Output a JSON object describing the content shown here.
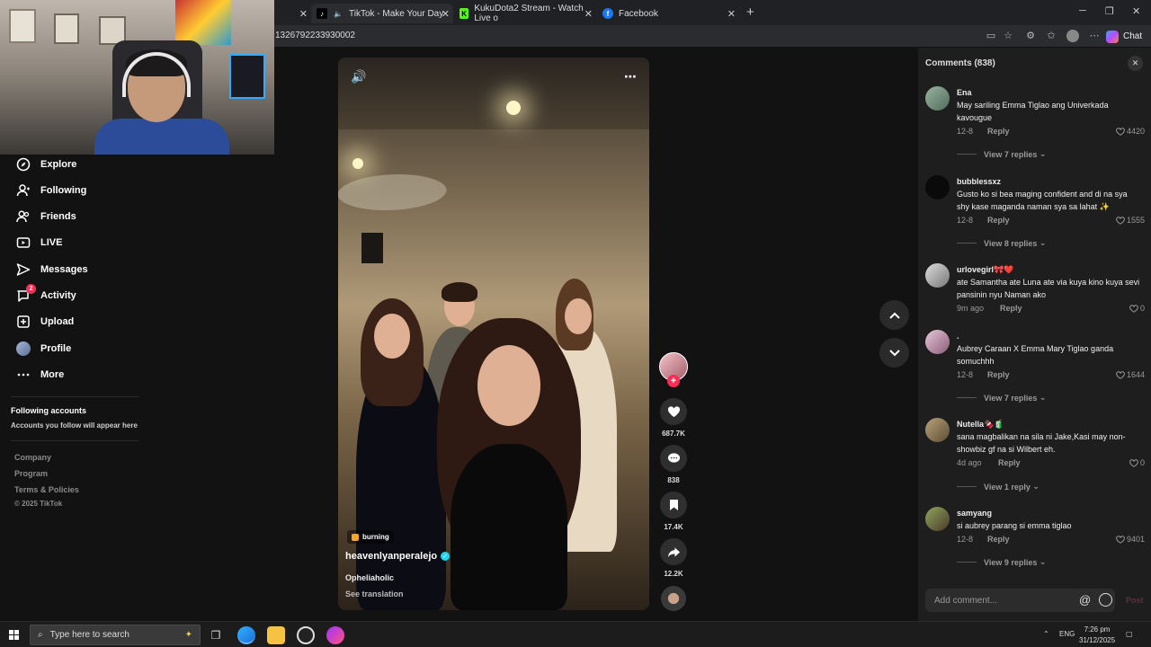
{
  "browser": {
    "tabs": [
      {
        "title": "TikTok - Make Your Day",
        "active": true
      },
      {
        "title": "KukuDota2 Stream - Watch Live o",
        "active": false
      },
      {
        "title": "Facebook",
        "active": false
      }
    ],
    "url": "1326792233930002",
    "chat_label": "Chat"
  },
  "sidebar": {
    "items": [
      {
        "label": "Explore",
        "icon": "compass-icon"
      },
      {
        "label": "Following",
        "icon": "user-follow-icon"
      },
      {
        "label": "Friends",
        "icon": "friends-icon"
      },
      {
        "label": "LIVE",
        "icon": "live-icon"
      },
      {
        "label": "Messages",
        "icon": "send-icon"
      },
      {
        "label": "Activity",
        "icon": "activity-icon",
        "badge": "2"
      },
      {
        "label": "Upload",
        "icon": "plus-square-icon"
      },
      {
        "label": "Profile",
        "icon": "avatar"
      },
      {
        "label": "More",
        "icon": "more-icon"
      }
    ],
    "following_heading": "Following accounts",
    "following_sub": "Accounts you follow will appear here",
    "footer": [
      "Company",
      "Program",
      "Terms & Policies"
    ],
    "copyright": "© 2025 TikTok"
  },
  "video": {
    "tag": "burning",
    "username": "heavenlyanperalejo",
    "description": "Opheliaholic",
    "translate": "See translation"
  },
  "actions": {
    "likes": "687.7K",
    "comments": "838",
    "saves": "17.4K",
    "shares": "12.2K"
  },
  "comments_panel": {
    "title": "Comments (838)",
    "items": [
      {
        "name": "Ena",
        "text": "May sariling Emma Tiglao ang Univerkada kavougue",
        "date": "12-8",
        "reply": "Reply",
        "likes": "4420",
        "view": "View 7 replies"
      },
      {
        "name": "bubblessxz",
        "text": "Gusto ko si bea maging confident and di na sya shy kase maganda naman sya sa lahat ✨",
        "date": "12-8",
        "reply": "Reply",
        "likes": "1555",
        "view": "View 8 replies"
      },
      {
        "name": "urlovegirl🎀❤️",
        "text": "ate Samantha ate Luna ate via kuya kino kuya sevi pansinin nyu Naman ako",
        "date": "9m ago",
        "reply": "Reply",
        "likes": "0",
        "view": ""
      },
      {
        "name": ".",
        "text": "Aubrey Caraan X Emma Mary Tiglao ganda somuchhh",
        "date": "12-8",
        "reply": "Reply",
        "likes": "1644",
        "view": "View 7 replies"
      },
      {
        "name": "Nutella🍫🧃",
        "text": "sana magbalikan na sila ni Jake,Kasi may non-showbiz gf na si Wilbert eh.",
        "date": "4d ago",
        "reply": "Reply",
        "likes": "0",
        "view": "View 1 reply"
      },
      {
        "name": "samyang",
        "text": "si aubrey parang si emma tiglao",
        "date": "12-8",
        "reply": "Reply",
        "likes": "9401",
        "view": "View 9 replies"
      }
    ],
    "input_placeholder": "Add comment...",
    "post_label": "Post"
  },
  "taskbar": {
    "search_placeholder": "Type here to search",
    "lang": "ENG",
    "time": "7:26 pm",
    "date": "31/12/2025"
  },
  "colors": {
    "accent": "#fe2c55",
    "verified": "#20d5ec",
    "panel": "#1e1e1e",
    "background": "#121212"
  }
}
